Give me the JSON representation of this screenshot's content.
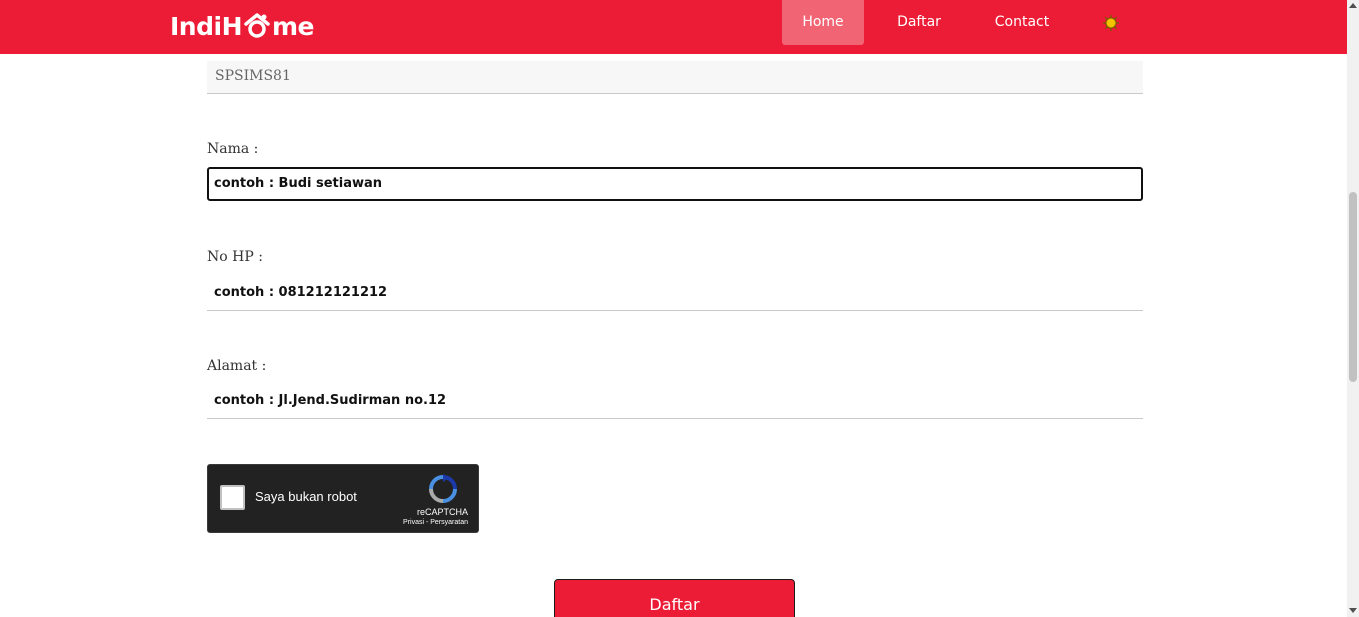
{
  "header": {
    "logo_text_left": "IndiH",
    "logo_text_right": "me",
    "nav": [
      {
        "label": "Home",
        "active": true
      },
      {
        "label": "Daftar",
        "active": false
      },
      {
        "label": "Contact",
        "active": false
      }
    ],
    "theme_icon": "sun-icon",
    "colors": {
      "brand": "#ec1c36",
      "active_tab": "#f06474",
      "sun": "#f5c400"
    }
  },
  "form": {
    "code_value": "SPSIMS81",
    "nama": {
      "label": "Nama :",
      "value": "contoh : Budi setiawan"
    },
    "no_hp": {
      "label": "No HP :",
      "value": "contoh : 081212121212"
    },
    "alamat": {
      "label": "Alamat :",
      "value": "contoh : Jl.Jend.Sudirman no.12"
    },
    "submit_label": "Daftar"
  },
  "recaptcha": {
    "label": "Saya bukan robot",
    "brand": "reCAPTCHA",
    "links": "Privasi - Persyaratan",
    "checked": false
  }
}
